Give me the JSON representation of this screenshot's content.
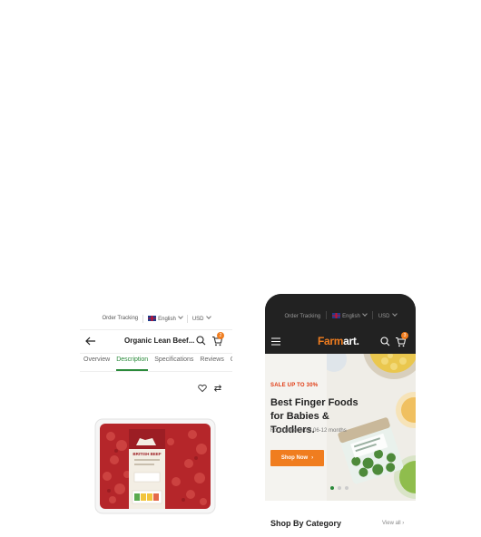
{
  "left_screen": {
    "topbar": {
      "order_tracking": "Order Tracking",
      "language": "English",
      "currency": "USD"
    },
    "header": {
      "title": "Organic Lean Beef...",
      "cart_count": "2"
    },
    "tabs": [
      "Overview",
      "Description",
      "Specifications",
      "Reviews",
      "Q"
    ],
    "active_tab": "Description",
    "product_image": {
      "package_label": "BRITISH BEEF"
    }
  },
  "right_screen": {
    "topbar": {
      "order_tracking": "Order Tracking",
      "language": "English",
      "currency": "USD"
    },
    "header": {
      "logo_main": "Farm",
      "logo_accent": "art.",
      "cart_count": "3"
    },
    "hero": {
      "sale_label": "SALE UP TO 30%",
      "title": "Best Finger Foods for Babies & Toddlers.",
      "subtitle": "For children from 06-12 months",
      "cta": "Shop Now",
      "slide_count": 3,
      "active_slide": 1
    },
    "category": {
      "title": "Shop By Category",
      "view_all": "View all"
    }
  },
  "colors": {
    "accent": "#f07d1f",
    "green": "#2a8a3a",
    "dark": "#222222",
    "sale_red": "#e03a12"
  }
}
